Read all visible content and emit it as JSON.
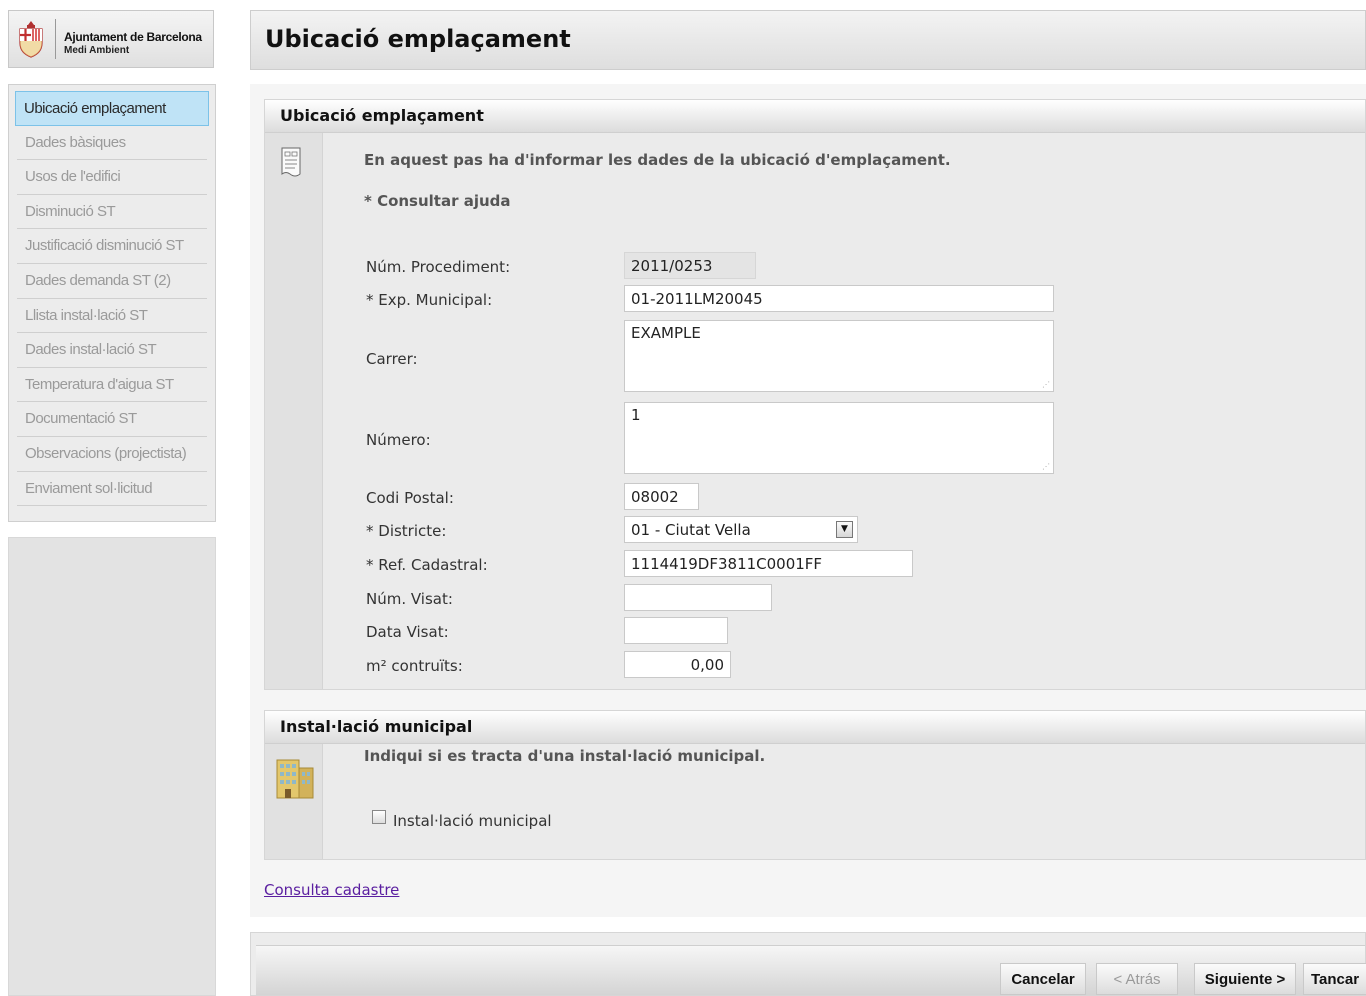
{
  "brand": {
    "name": "Ajuntament de Barcelona",
    "department": "Medi Ambient"
  },
  "sidebar": {
    "items": [
      {
        "label": "Ubicació emplaçament",
        "active": true
      },
      {
        "label": "Dades bàsiques"
      },
      {
        "label": "Usos de l'edifici"
      },
      {
        "label": "Disminució ST"
      },
      {
        "label": "Justificació disminució ST"
      },
      {
        "label": "Dades demanda ST (2)"
      },
      {
        "label": "Llista instal·lació ST"
      },
      {
        "label": "Dades instal·lació ST"
      },
      {
        "label": "Temperatura d'aigua ST"
      },
      {
        "label": "Documentació ST"
      },
      {
        "label": "Observacions (projectista)"
      },
      {
        "label": "Enviament sol·licitud"
      }
    ]
  },
  "header": {
    "title": "Ubicació emplaçament"
  },
  "location_section": {
    "title": "Ubicació emplaçament",
    "icon": "document-icon",
    "intro": "En aquest pas ha d'informar les dades de la ubicació d'emplaçament.",
    "help_link": "* Consultar ajuda",
    "fields": {
      "procediment": {
        "label": "Núm. Procediment:",
        "value": "2011/0253"
      },
      "exp_municipal": {
        "label": "* Exp. Municipal:",
        "value": "01-2011LM20045"
      },
      "carrer": {
        "label": "Carrer:",
        "value": "EXAMPLE"
      },
      "numero": {
        "label": "Número:",
        "value": "1"
      },
      "codi_postal": {
        "label": "Codi Postal:",
        "value": "08002"
      },
      "districte": {
        "label": "* Districte:",
        "value": "01 - Ciutat Vella"
      },
      "ref_cadastral": {
        "label": "* Ref. Cadastral:",
        "value": "1114419DF3811C0001FF"
      },
      "num_visat": {
        "label": "Núm. Visat:",
        "value": ""
      },
      "data_visat": {
        "label": "Data Visat:",
        "value": ""
      },
      "m2": {
        "label": "m² contruïts:",
        "value": "0,00"
      }
    }
  },
  "municipal_section": {
    "title": "Instal·lació municipal",
    "icon": "building-icon",
    "intro": "Indiqui si es tracta d'una instal·lació municipal.",
    "checkbox_label": "Instal·lació municipal",
    "checked": false
  },
  "cadastre_link": "Consulta cadastre",
  "footer": {
    "cancel": "Cancelar",
    "back": "< Atrás",
    "next": "Siguiente >",
    "close": "Tancar"
  }
}
